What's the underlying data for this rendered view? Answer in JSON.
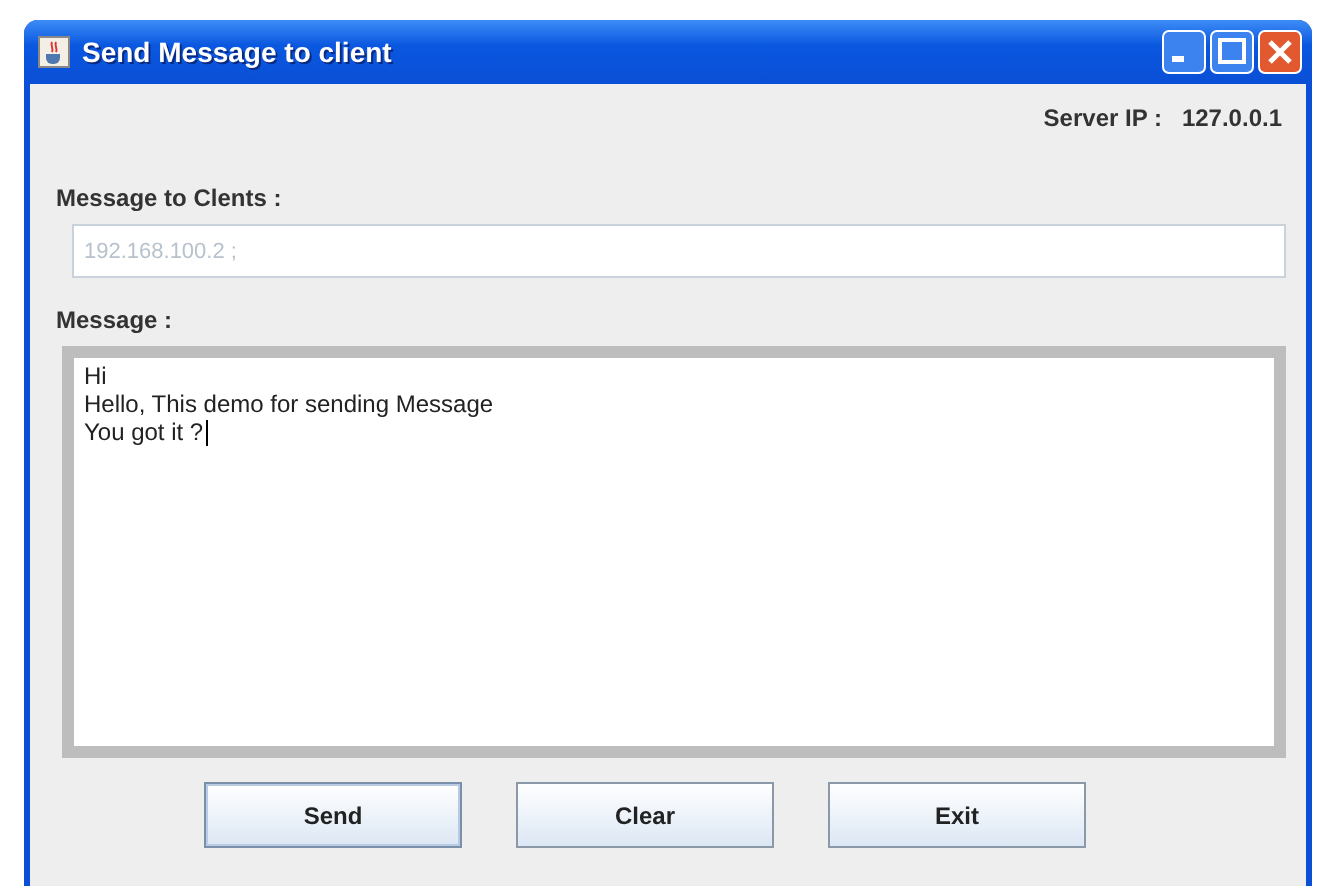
{
  "window": {
    "title": "Send Message to client"
  },
  "server_ip": {
    "label": "Server IP :",
    "value": "127.0.0.1"
  },
  "clients_field": {
    "label": "Message to Clents :",
    "placeholder": "192.168.100.2 ;"
  },
  "message": {
    "label": "Message :",
    "lines": [
      "Hi",
      "Hello, This demo for sending Message",
      "You got it ?"
    ],
    "focused": true
  },
  "buttons": [
    {
      "label": "Send",
      "focused": true
    },
    {
      "label": "Clear",
      "focused": false
    },
    {
      "label": "Exit",
      "focused": false
    }
  ]
}
